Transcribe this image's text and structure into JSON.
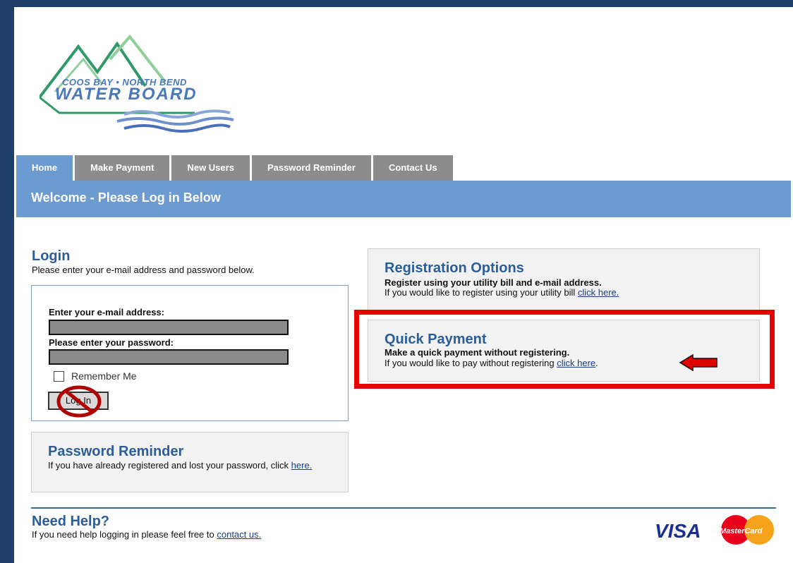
{
  "logo": {
    "line1": "COOS BAY • NORTH BEND",
    "line2": "WATER BOARD"
  },
  "nav": {
    "tabs": [
      "Home",
      "Make Payment",
      "New Users",
      "Password Reminder",
      "Contact Us"
    ],
    "active": "Home"
  },
  "welcome": {
    "title": "Welcome - Please Log in Below"
  },
  "login": {
    "title": "Login",
    "subtitle": "Please enter your e-mail address and password below.",
    "email_label": "Enter your e-mail address:",
    "password_label": "Please enter your password:",
    "remember_label": "Remember Me",
    "button_label": "Log In"
  },
  "password_reminder": {
    "title": "Password Reminder",
    "text": "If you have already registered and lost your password, click ",
    "link": "here."
  },
  "registration": {
    "title": "Registration Options",
    "bold": "Register using your utility bill and e-mail address.",
    "text": "If you would like to register using your utility bill ",
    "link": "click here."
  },
  "quick_payment": {
    "title": "Quick Payment",
    "bold": "Make a quick payment without registering.",
    "text": "If you would like to pay without registering ",
    "link": "click here",
    "trailing": "."
  },
  "help": {
    "title": "Need Help?",
    "text": "If you need help logging in please feel free to ",
    "link": "contact us."
  },
  "cards": {
    "visa": "VISA",
    "mastercard": "MasterCard"
  },
  "colors": {
    "brand_blue": "#6b9bd0",
    "heading_blue": "#2b5d99",
    "frame_navy": "#1f3f6b",
    "highlight_red": "#e60000",
    "tab_gray": "#8c8c8c"
  }
}
